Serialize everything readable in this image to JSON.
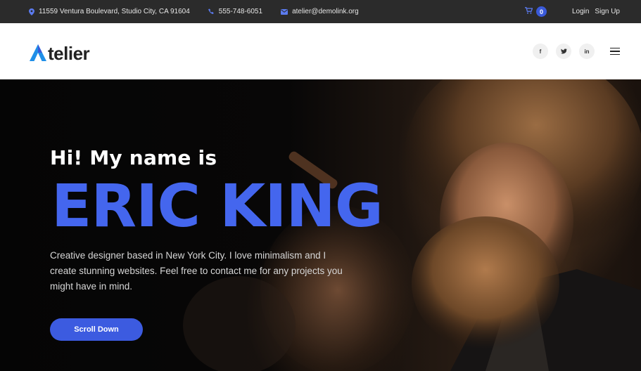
{
  "topbar": {
    "address": "11559 Ventura Boulevard, Studio City, CA 91604",
    "phone": "555-748-6051",
    "email": "atelier@demolink.org",
    "cart_count": "0",
    "login": "Login",
    "signup": "Sign Up",
    "icons": [
      "map-pin-icon",
      "phone-icon",
      "mail-icon",
      "cart-icon"
    ],
    "accent": "#3a5ad9"
  },
  "header": {
    "logo_letter": "A",
    "logo_text": "telier",
    "social": [
      {
        "name": "facebook",
        "glyph": "f"
      },
      {
        "name": "twitter",
        "glyph": "t"
      },
      {
        "name": "linkedin",
        "glyph": "in"
      }
    ]
  },
  "hero": {
    "greeting": "Hi! My name is",
    "name": "ERIC KING",
    "description": "Creative designer based in New York City. I love minimalism and I create stunning websites. Feel free to contact me for any projects you might have in mind.",
    "cta": "Scroll Down",
    "name_color": "#4466ee"
  }
}
